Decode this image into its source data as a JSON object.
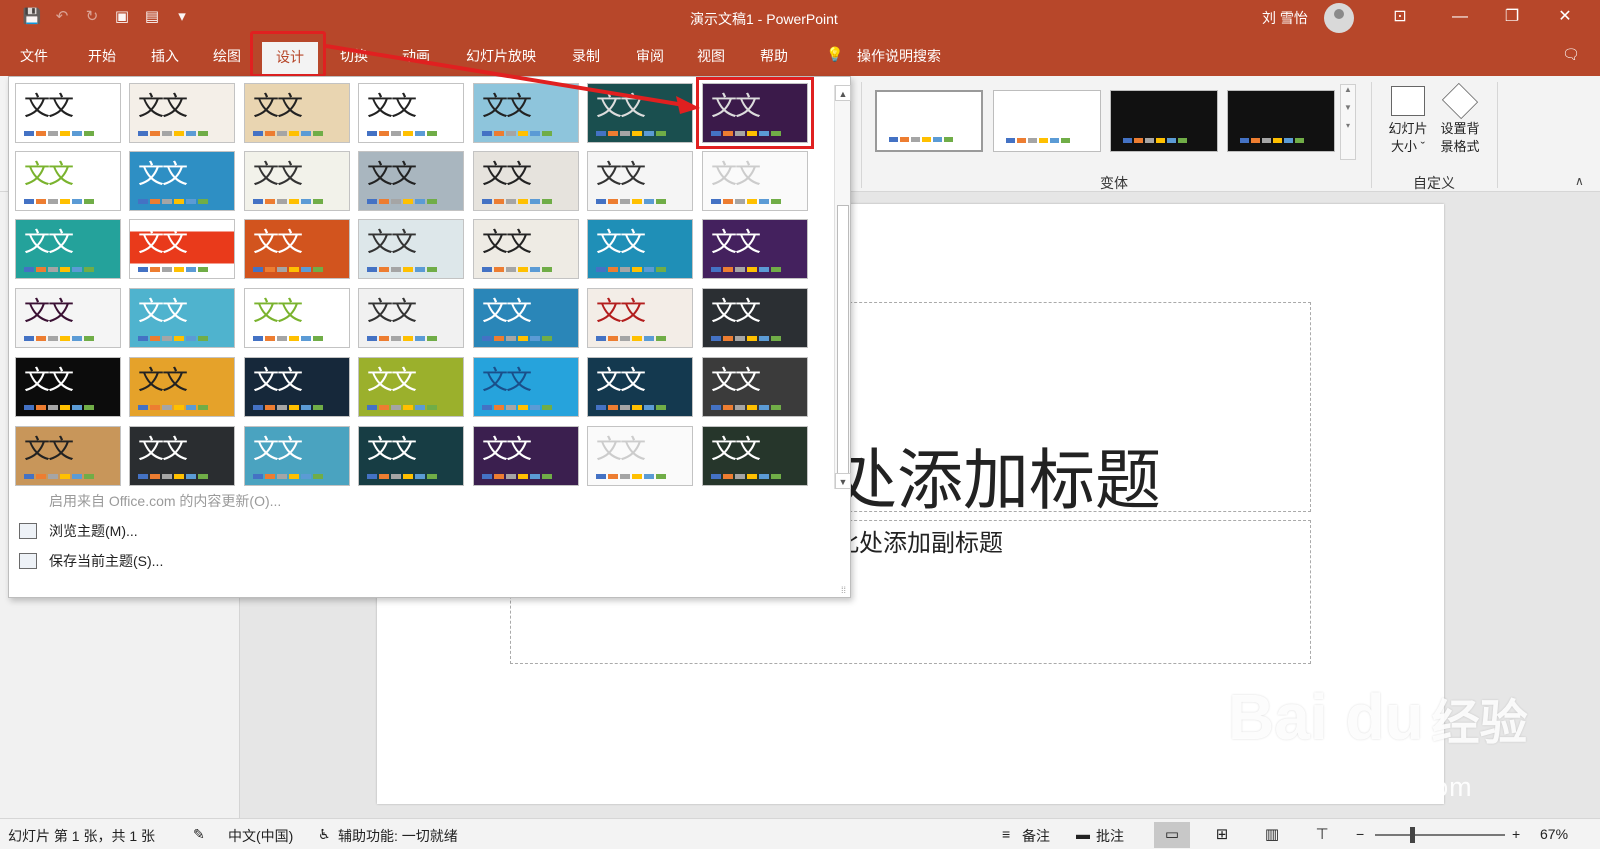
{
  "window": {
    "title": "演示文稿1 - PowerPoint",
    "user": "刘 雪怡",
    "accent": "#b7472a",
    "highlight": "#e02020"
  },
  "qat": [
    "save-icon",
    "undo-icon",
    "redo-icon",
    "present-icon",
    "slide-icon",
    "customize-icon"
  ],
  "tabs": [
    {
      "label": "文件"
    },
    {
      "label": "开始"
    },
    {
      "label": "插入"
    },
    {
      "label": "绘图"
    },
    {
      "label": "设计"
    },
    {
      "label": "切换"
    },
    {
      "label": "动画"
    },
    {
      "label": "幻灯片放映"
    },
    {
      "label": "录制"
    },
    {
      "label": "审阅"
    },
    {
      "label": "视图"
    },
    {
      "label": "帮助"
    },
    {
      "label": "操作说明搜索"
    }
  ],
  "ribbon": {
    "variants_label": "变体",
    "customize_label": "自定义",
    "slide_size_label": "幻灯片\n大小",
    "slide_size_l1": "幻灯片",
    "slide_size_l2": "大小 ˇ",
    "bg_format_l1": "设置背",
    "bg_format_l2": "景格式"
  },
  "gallery": {
    "theme_text": "文文",
    "menu_update": "启用来自 Office.com 的内容更新(O)...",
    "menu_browse": "浏览主题(M)...",
    "menu_save": "保存当前主题(S)..."
  },
  "slide": {
    "title_placeholder": "处添加标题",
    "subtitle_placeholder": "此处添加副标题"
  },
  "status": {
    "slide_info": "幻灯片 第 1 张，共 1 张",
    "language": "中文(中国)",
    "accessibility": "辅助功能: 一切就绪",
    "notes": "备注",
    "comments": "批注",
    "zoom": "67%",
    "minus": "−",
    "plus": "+"
  },
  "watermark": {
    "brand": "Bai  du",
    "cn": "经验",
    "url": "jingyan.baidu.com"
  }
}
